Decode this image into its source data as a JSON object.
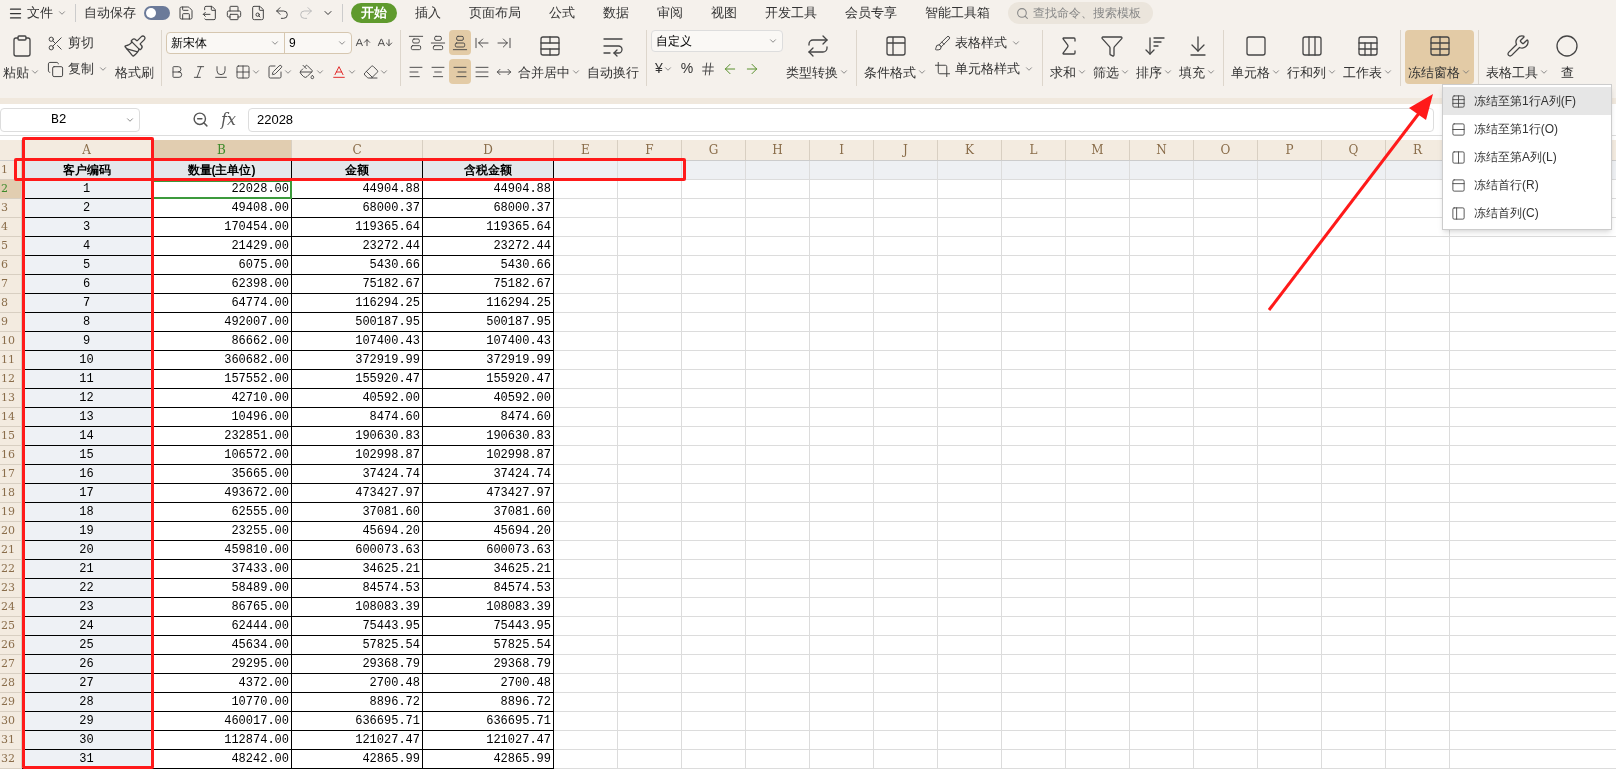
{
  "menu_bar": {
    "file_menu": "文件",
    "autosave_label": "自动保存",
    "autosave_on": false,
    "tabs": [
      {
        "label": "开始",
        "selected": true
      },
      {
        "label": "插入",
        "selected": false
      },
      {
        "label": "页面布局",
        "selected": false
      },
      {
        "label": "公式",
        "selected": false
      },
      {
        "label": "数据",
        "selected": false
      },
      {
        "label": "审阅",
        "selected": false
      },
      {
        "label": "视图",
        "selected": false
      },
      {
        "label": "开发工具",
        "selected": false
      },
      {
        "label": "会员专享",
        "selected": false
      },
      {
        "label": "智能工具箱",
        "selected": false
      }
    ],
    "search": {
      "placeholder": "查找命令、搜索模板"
    }
  },
  "ribbon": {
    "paste": "粘贴",
    "cut": "剪切",
    "copy": "复制",
    "format_painter": "格式刷",
    "font_name": "新宋体",
    "font_size": "9",
    "vertical_align": [
      {
        "selected": false
      },
      {
        "selected": false
      },
      {
        "selected": true
      }
    ],
    "horizontal_align": [
      {
        "selected": false
      },
      {
        "selected": false
      },
      {
        "selected": true
      },
      {
        "selected": false
      }
    ],
    "merge_center": "合并居中",
    "wrap_text": "自动换行",
    "number_format": "自定义",
    "currency": "¥",
    "percent": "%",
    "convert": "类型转换",
    "conditional_format": "条件格式",
    "table_style": "表格样式",
    "cell_style": "单元格样式",
    "sum": "求和",
    "filter": "筛选",
    "sort": "排序",
    "fill": "填充",
    "cells": "单元格",
    "rows_cols": "行和列",
    "worksheet": "工作表",
    "freeze_panes": {
      "label": "冻结窗格",
      "selected": true
    },
    "table_tools": "表格工具",
    "find": "查"
  },
  "freeze_menu": [
    {
      "label": "冻结至第1行A列(F)",
      "selected": true
    },
    {
      "label": "冻结至第1行(O)",
      "selected": false
    },
    {
      "label": "冻结至第A列(L)",
      "selected": false
    },
    {
      "label": "冻结首行(R)",
      "selected": false
    },
    {
      "label": "冻结首列(C)",
      "selected": false
    }
  ],
  "formula_bar": {
    "name_box": "B2",
    "fx_label": "fx",
    "formula": "22028"
  },
  "sheet": {
    "columns": [
      {
        "label": "A",
        "selected": false
      },
      {
        "label": "B",
        "selected": true
      },
      {
        "label": "C",
        "selected": false
      },
      {
        "label": "D",
        "selected": false
      },
      {
        "label": "E",
        "selected": false
      },
      {
        "label": "F",
        "selected": false
      },
      {
        "label": "G",
        "selected": false
      },
      {
        "label": "H",
        "selected": false
      },
      {
        "label": "I",
        "selected": false
      },
      {
        "label": "J",
        "selected": false
      },
      {
        "label": "K",
        "selected": false
      },
      {
        "label": "L",
        "selected": false
      },
      {
        "label": "M",
        "selected": false
      },
      {
        "label": "N",
        "selected": false
      },
      {
        "label": "O",
        "selected": false
      },
      {
        "label": "P",
        "selected": false
      },
      {
        "label": "Q",
        "selected": false
      },
      {
        "label": "R",
        "selected": false
      }
    ],
    "header_row": {
      "number": "1",
      "selected": false,
      "cells": [
        "客户编码",
        "数量(主单位)",
        "金额",
        "含税金额"
      ]
    },
    "rows": [
      {
        "number": "2",
        "selected": true,
        "cells": [
          "1",
          "22028.00",
          "44904.88",
          "44904.88"
        ]
      },
      {
        "number": "3",
        "selected": false,
        "cells": [
          "2",
          "49408.00",
          "68000.37",
          "68000.37"
        ]
      },
      {
        "number": "4",
        "selected": false,
        "cells": [
          "3",
          "170454.00",
          "119365.64",
          "119365.64"
        ]
      },
      {
        "number": "5",
        "selected": false,
        "cells": [
          "4",
          "21429.00",
          "23272.44",
          "23272.44"
        ]
      },
      {
        "number": "6",
        "selected": false,
        "cells": [
          "5",
          "6075.00",
          "5430.66",
          "5430.66"
        ]
      },
      {
        "number": "7",
        "selected": false,
        "cells": [
          "6",
          "62398.00",
          "75182.67",
          "75182.67"
        ]
      },
      {
        "number": "8",
        "selected": false,
        "cells": [
          "7",
          "64774.00",
          "116294.25",
          "116294.25"
        ]
      },
      {
        "number": "9",
        "selected": false,
        "cells": [
          "8",
          "492007.00",
          "500187.95",
          "500187.95"
        ]
      },
      {
        "number": "10",
        "selected": false,
        "cells": [
          "9",
          "86662.00",
          "107400.43",
          "107400.43"
        ]
      },
      {
        "number": "11",
        "selected": false,
        "cells": [
          "10",
          "360682.00",
          "372919.99",
          "372919.99"
        ]
      },
      {
        "number": "12",
        "selected": false,
        "cells": [
          "11",
          "157552.00",
          "155920.47",
          "155920.47"
        ]
      },
      {
        "number": "13",
        "selected": false,
        "cells": [
          "12",
          "42710.00",
          "40592.00",
          "40592.00"
        ]
      },
      {
        "number": "14",
        "selected": false,
        "cells": [
          "13",
          "10496.00",
          "8474.60",
          "8474.60"
        ]
      },
      {
        "number": "15",
        "selected": false,
        "cells": [
          "14",
          "232851.00",
          "190630.83",
          "190630.83"
        ]
      },
      {
        "number": "16",
        "selected": false,
        "cells": [
          "15",
          "106572.00",
          "102998.87",
          "102998.87"
        ]
      },
      {
        "number": "17",
        "selected": false,
        "cells": [
          "16",
          "35665.00",
          "37424.74",
          "37424.74"
        ]
      },
      {
        "number": "18",
        "selected": false,
        "cells": [
          "17",
          "493672.00",
          "473427.97",
          "473427.97"
        ]
      },
      {
        "number": "19",
        "selected": false,
        "cells": [
          "18",
          "62555.00",
          "37081.60",
          "37081.60"
        ]
      },
      {
        "number": "20",
        "selected": false,
        "cells": [
          "19",
          "23255.00",
          "45694.20",
          "45694.20"
        ]
      },
      {
        "number": "21",
        "selected": false,
        "cells": [
          "20",
          "459810.00",
          "600073.63",
          "600073.63"
        ]
      },
      {
        "number": "22",
        "selected": false,
        "cells": [
          "21",
          "37433.00",
          "34625.21",
          "34625.21"
        ]
      },
      {
        "number": "23",
        "selected": false,
        "cells": [
          "22",
          "58489.00",
          "84574.53",
          "84574.53"
        ]
      },
      {
        "number": "24",
        "selected": false,
        "cells": [
          "23",
          "86765.00",
          "108083.39",
          "108083.39"
        ]
      },
      {
        "number": "25",
        "selected": false,
        "cells": [
          "24",
          "62444.00",
          "75443.95",
          "75443.95"
        ]
      },
      {
        "number": "26",
        "selected": false,
        "cells": [
          "25",
          "45634.00",
          "57825.54",
          "57825.54"
        ]
      },
      {
        "number": "27",
        "selected": false,
        "cells": [
          "26",
          "29295.00",
          "29368.79",
          "29368.79"
        ]
      },
      {
        "number": "28",
        "selected": false,
        "cells": [
          "27",
          "4372.00",
          "2700.48",
          "2700.48"
        ]
      },
      {
        "number": "29",
        "selected": false,
        "cells": [
          "28",
          "10770.00",
          "8896.72",
          "8896.72"
        ]
      },
      {
        "number": "30",
        "selected": false,
        "cells": [
          "29",
          "460017.00",
          "636695.71",
          "636695.71"
        ]
      },
      {
        "number": "31",
        "selected": false,
        "cells": [
          "30",
          "112874.00",
          "121027.47",
          "121027.47"
        ]
      },
      {
        "number": "32",
        "selected": false,
        "cells": [
          "31",
          "48242.00",
          "42865.99",
          "42865.99"
        ]
      }
    ]
  }
}
